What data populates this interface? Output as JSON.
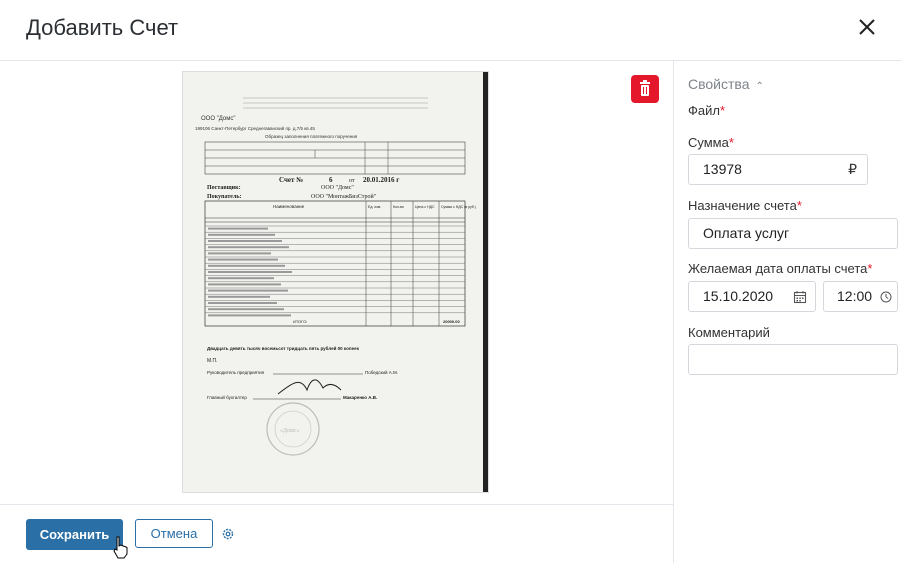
{
  "dialog": {
    "title": "Добавить Счет"
  },
  "footer": {
    "save_label": "Сохранить",
    "cancel_label": "Отмена"
  },
  "properties": {
    "section_title": "Свойства",
    "file_label": "Файл",
    "amount_label": "Сумма",
    "amount_value": "13978",
    "currency": "₽",
    "purpose_label": "Назначение счета",
    "purpose_value": "Оплата услуг",
    "due_label": "Желаемая дата оплаты счета",
    "due_date": "15.10.2020",
    "due_time": "12:00",
    "comment_label": "Комментарий",
    "comment_value": ""
  },
  "invoice": {
    "seller": "ООО \"Домс\"",
    "address": "199106 Санкт-Петербург Среднегаванский пр. д.7/5 кв.45",
    "sample": "Образец заполнения платежного поручения",
    "heading": "Счет",
    "number_label": "№",
    "number": "6",
    "date_label": "от",
    "date": "20.01.2016 г",
    "supplier_label": "Поставщик:",
    "supplier_value": "ООО \"Домс\"",
    "buyer_label": "Покупатель:",
    "buyer_value": "ООО \"МонтажБизСтрой\"",
    "columns": [
      "Наименование",
      "Ед. изм.",
      "Кол-во",
      "Цена с НДС",
      "Сумма с НДС (в руб.)"
    ],
    "total_label": "ИТОГО:",
    "total_value": "20000.00",
    "in_words": "Двадцать девять тысяч восемьсот тридцать пять рублей 00 копеек",
    "mp": "М.П.",
    "director_label": "Руководитель предприятия",
    "director_name": "Победский А.М.",
    "accountant_label": "Главный бухгалтер",
    "accountant_name": "Макаренко А.В.",
    "stamp": "«Домс»"
  }
}
